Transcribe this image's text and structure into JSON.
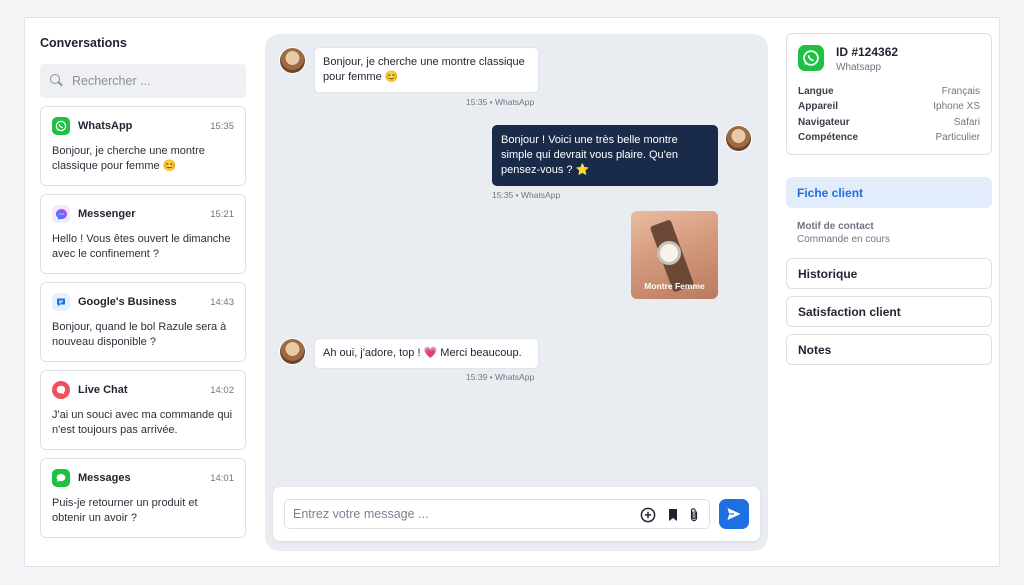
{
  "sidebar": {
    "title": "Conversations",
    "search_placeholder": "Rechercher ...",
    "conversations": [
      {
        "channel": "WhatsApp",
        "time": "15:35",
        "text": "Bonjour, je cherche une montre classique pour femme 😊",
        "icon": "whatsapp-icon",
        "color": "#1fc141"
      },
      {
        "channel": "Messenger",
        "time": "15:21",
        "text": "Hello ! Vous êtes ouvert le dimanche avec le confinement ?",
        "icon": "messenger-icon",
        "color": "#a334fa"
      },
      {
        "channel": "Google's Business",
        "time": "14:43",
        "text": "Bonjour, quand le bol Razule sera à nouveau disponible ?",
        "icon": "google-business-icon",
        "color": "#1a73e8"
      },
      {
        "channel": "Live Chat",
        "time": "14:02",
        "text": "J'ai un souci avec ma commande qui n'est toujours pas arrivée.",
        "icon": "live-chat-icon",
        "color": "#f0505a"
      },
      {
        "channel": "Messages",
        "time": "14:01",
        "text": "Puis-je retourner un produit et obtenir un avoir ?",
        "icon": "messages-icon",
        "color": "#1fc141"
      }
    ]
  },
  "chat": {
    "messages": [
      {
        "text": "Bonjour, je cherche une montre classique pour femme 😊",
        "meta": "15:35 • WhatsApp"
      },
      {
        "text": "Bonjour ! Voici une très belle montre simple qui devrait vous plaire. Qu'en pensez-vous ? ⭐",
        "meta": "15:35 • WhatsApp"
      },
      {
        "text": "Ah oui, j'adore, top ! 💗 Merci beaucoup.",
        "meta": "15:39 • WhatsApp"
      }
    ],
    "photo_label": "Montre Femme",
    "composer_placeholder": "Entrez votre message ..."
  },
  "client": {
    "id": "ID #124362",
    "channel": "Whatsapp",
    "info": [
      {
        "key": "Langue",
        "value": "Français"
      },
      {
        "key": "Appareil",
        "value": "Iphone XS"
      },
      {
        "key": "Navigateur",
        "value": "Safari"
      },
      {
        "key": "Compétence",
        "value": "Particulier"
      }
    ],
    "active_tab": "Fiche client",
    "motif_label": "Motif de contact",
    "motif_value": "Commande en cours",
    "sections": [
      "Historique",
      "Satisfaction client",
      "Notes"
    ]
  },
  "colors": {
    "accent": "#1e6fe0",
    "dark_bubble": "#1a2b4a",
    "whatsapp": "#1fc141"
  }
}
